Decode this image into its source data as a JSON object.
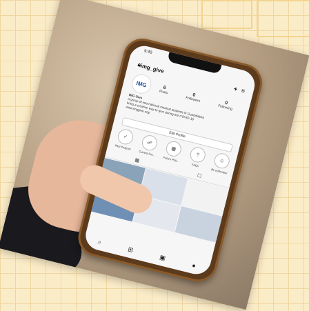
{
  "phone": {
    "status_time": "9:40",
    "username": "img_give",
    "profile": {
      "avatar_text": "IMG",
      "stats": [
        {
          "value": "6",
          "label": "Posts"
        },
        {
          "value": "0",
          "label": "Followers"
        },
        {
          "value": "0",
          "label": "Following"
        }
      ],
      "bio_name": "IMG Give",
      "bio_lines": [
        "a group of international medical students in Guadalajara",
        "bring a creative way to give during the COVID-19",
        "www.imggive.org/"
      ]
    },
    "edit_profile_label": "Edit Profile",
    "highlights": [
      {
        "label": "Past Projects",
        "icon": "check-icon",
        "glyph": "✓"
      },
      {
        "label": "Current Pro...",
        "icon": "handshake-icon",
        "glyph": "☍"
      },
      {
        "label": "Future Proj...",
        "icon": "calendar-icon",
        "glyph": "▦"
      },
      {
        "label": "FAQs",
        "icon": "question-icon",
        "glyph": "?"
      },
      {
        "label": "Be a Member",
        "icon": "person-icon",
        "glyph": "☺"
      }
    ],
    "tabs": [
      {
        "icon": "grid-icon",
        "glyph": "▦"
      },
      {
        "icon": "tagged-icon",
        "glyph": "☐"
      }
    ],
    "tabbar": [
      {
        "icon": "search-icon",
        "glyph": "⌕"
      },
      {
        "icon": "add-post-icon",
        "glyph": "⊞"
      },
      {
        "icon": "shop-icon",
        "glyph": "▣"
      },
      {
        "icon": "profile-icon",
        "glyph": "●"
      }
    ]
  }
}
